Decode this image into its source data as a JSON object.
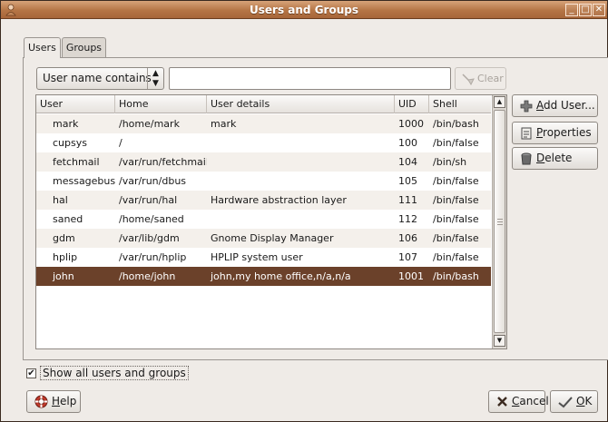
{
  "window": {
    "title": "Users and Groups"
  },
  "tabs": [
    {
      "label": "Users"
    },
    {
      "label": "Groups"
    }
  ],
  "filter": {
    "mode_label": "User name contains",
    "text_value": "",
    "clear_label": "Clear"
  },
  "table": {
    "headers": {
      "user": "User",
      "home": "Home",
      "details": "User details",
      "uid": "UID",
      "shell": "Shell"
    },
    "rows": [
      {
        "user": "mark",
        "home": "/home/mark",
        "details": "mark",
        "uid": "1000",
        "shell": "/bin/bash"
      },
      {
        "user": "cupsys",
        "home": "/",
        "details": "",
        "uid": "100",
        "shell": "/bin/false"
      },
      {
        "user": "fetchmail",
        "home": "/var/run/fetchmail",
        "details": "",
        "uid": "104",
        "shell": "/bin/sh"
      },
      {
        "user": "messagebus",
        "home": "/var/run/dbus",
        "details": "",
        "uid": "105",
        "shell": "/bin/false"
      },
      {
        "user": "hal",
        "home": "/var/run/hal",
        "details": "Hardware abstraction layer",
        "uid": "111",
        "shell": "/bin/false"
      },
      {
        "user": "saned",
        "home": "/home/saned",
        "details": "",
        "uid": "112",
        "shell": "/bin/false"
      },
      {
        "user": "gdm",
        "home": "/var/lib/gdm",
        "details": "Gnome Display Manager",
        "uid": "106",
        "shell": "/bin/false"
      },
      {
        "user": "hplip",
        "home": "/var/run/hplip",
        "details": "HPLIP system user",
        "uid": "107",
        "shell": "/bin/false"
      },
      {
        "user": "john",
        "home": "/home/john",
        "details": "john,my home office,n/a,n/a",
        "uid": "1001",
        "shell": "/bin/bash",
        "selected": true
      }
    ]
  },
  "side_buttons": {
    "add_user_prefix": "A",
    "add_user_rest": "dd User...",
    "properties_prefix": "P",
    "properties_rest": "roperties",
    "delete_prefix": "D",
    "delete_rest": "elete"
  },
  "options": {
    "show_all_label": "Show all users and groups",
    "show_all_checked": true
  },
  "footer": {
    "help_prefix": "H",
    "help_rest": "elp",
    "cancel_prefix": "C",
    "cancel_rest": "ancel",
    "ok_prefix": "O",
    "ok_rest": "K"
  },
  "icons": {
    "app": "users-icon",
    "clear": "broom-icon",
    "add": "plus-icon",
    "properties": "properties-icon",
    "delete": "trash-icon",
    "help": "lifebuoy-icon",
    "cancel": "x-icon",
    "ok": "check-icon"
  },
  "colors": {
    "title_bar": "#b57545",
    "selection": "#6b412a"
  }
}
